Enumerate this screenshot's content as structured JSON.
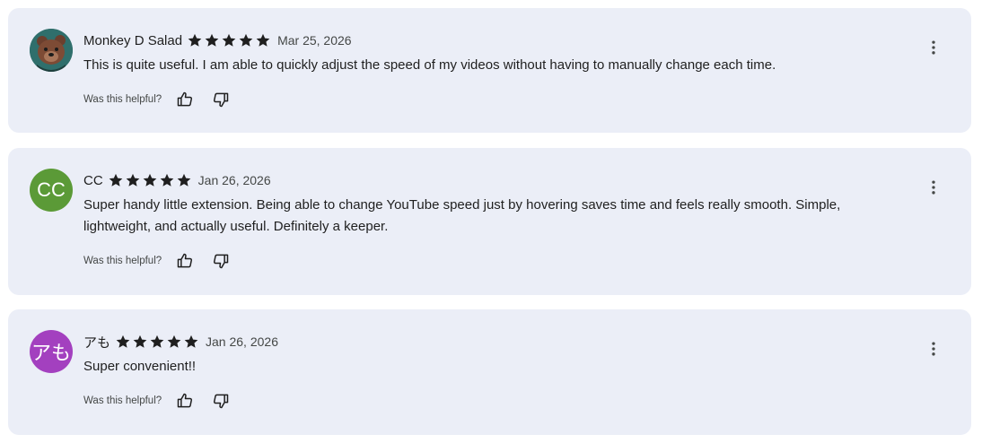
{
  "helpful_label": "Was this helpful?",
  "colors": {
    "card_bg": "#ebeef7",
    "star": "#1f1f1f",
    "avatar_cc": "#5b9a37",
    "avatar_amo": "#a340bf"
  },
  "icons": {
    "star": "star-icon",
    "thumb_up": "thumb-up-icon",
    "thumb_down": "thumb-down-icon",
    "more": "more-vert-icon"
  },
  "reviews": [
    {
      "author": "Monkey D Salad",
      "rating": 5,
      "date": "Mar 25, 2026",
      "text": "This is quite useful. I am able to quickly adjust the speed of my videos without having to manually change each time.",
      "avatar_initials": ""
    },
    {
      "author": "CC",
      "rating": 5,
      "date": "Jan 26, 2026",
      "text": "Super handy little extension. Being able to change YouTube speed just by hovering saves time and feels really smooth. Simple, lightweight, and actually useful. Definitely a keeper.",
      "avatar_initials": "CC"
    },
    {
      "author": "アも",
      "rating": 5,
      "date": "Jan 26, 2026",
      "text": "Super convenient!!",
      "avatar_initials": "アも"
    }
  ]
}
